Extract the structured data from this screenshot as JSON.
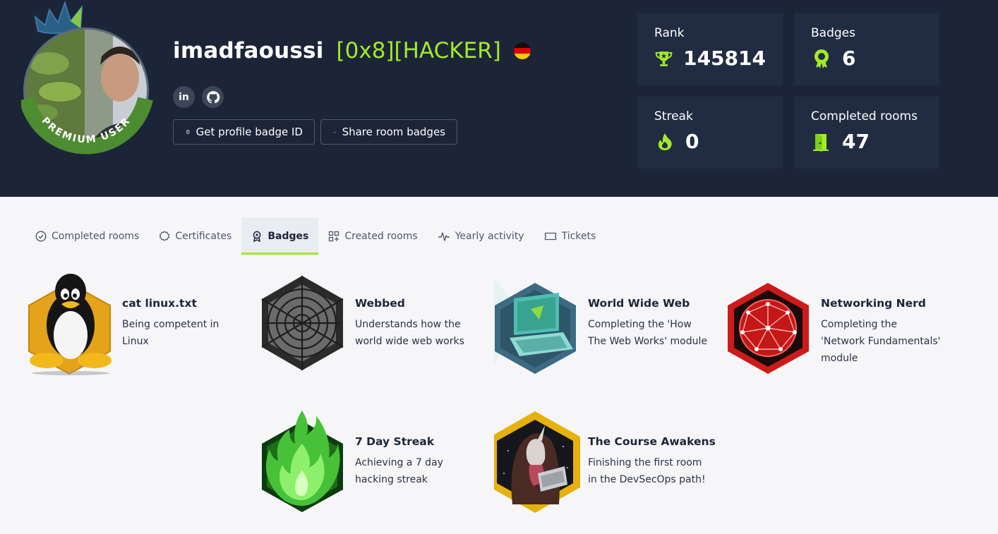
{
  "profile": {
    "username": "imadfaoussi",
    "title": "[0x8][HACKER]",
    "flag": "germany-flag",
    "avatar_ribbon": "PREMIUM USER",
    "social": [
      {
        "name": "linkedin",
        "glyph": "in"
      },
      {
        "name": "github",
        "glyph": "github-icon"
      }
    ],
    "buttons": {
      "badge_id": "Get profile badge ID",
      "share": "Share room badges"
    }
  },
  "stats": {
    "rank": {
      "label": "Rank",
      "value": "145814",
      "icon": "trophy-icon"
    },
    "badges": {
      "label": "Badges",
      "value": "6",
      "icon": "award-icon"
    },
    "streak": {
      "label": "Streak",
      "value": "0",
      "icon": "flame-icon"
    },
    "rooms": {
      "label": "Completed rooms",
      "value": "47",
      "icon": "door-icon"
    }
  },
  "tabs": [
    {
      "label": "Completed rooms",
      "icon": "check-circle-icon"
    },
    {
      "label": "Certificates",
      "icon": "certificate-icon"
    },
    {
      "label": "Badges",
      "icon": "badge-icon",
      "active": true
    },
    {
      "label": "Created rooms",
      "icon": "grid-plus-icon"
    },
    {
      "label": "Yearly activity",
      "icon": "activity-icon"
    },
    {
      "label": "Tickets",
      "icon": "ticket-icon"
    }
  ],
  "badges": [
    {
      "name": "cat linux.txt",
      "description": "Being competent in Linux",
      "icon": "linux-penguin-icon"
    },
    {
      "name": "Webbed",
      "description": "Understands how the world wide web works",
      "icon": "spider-web-icon"
    },
    {
      "name": "World Wide Web",
      "description": "Completing the 'How The Web Works' module",
      "icon": "laptop-icon"
    },
    {
      "name": "Networking Nerd",
      "description": "Completing the 'Network Fundamentals' module",
      "icon": "network-globe-icon"
    },
    {
      "name": "7 Day Streak",
      "description": "Achieving a 7 day hacking streak",
      "icon": "green-flame-icon"
    },
    {
      "name": "The Course Awakens",
      "description": "Finishing the first room in the DevSecOps path!",
      "icon": "hooded-unicorn-icon"
    }
  ],
  "colors": {
    "header_bg": "#1c2538",
    "card_bg": "#212c42",
    "accent": "#a3ea2a",
    "page_bg": "#f6f6f9"
  }
}
